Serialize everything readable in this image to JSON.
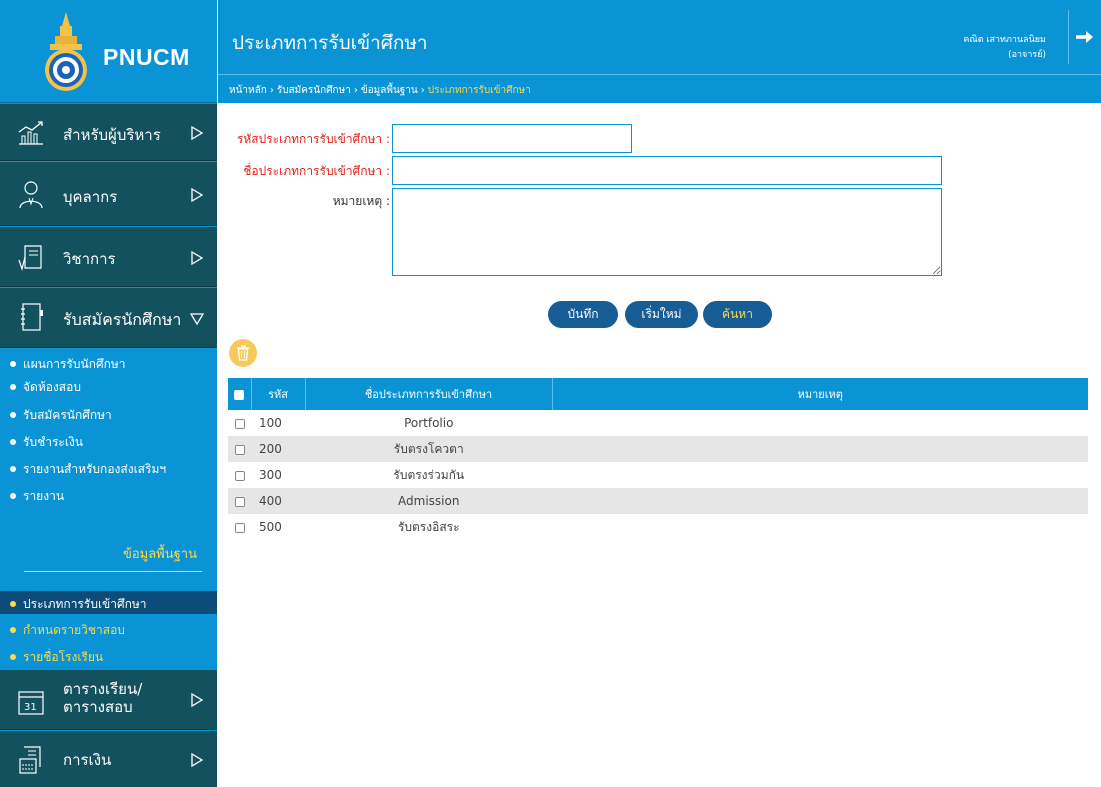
{
  "app": {
    "logo_text": "PNUCM"
  },
  "header": {
    "title": "ประเภทการรับเข้าศึกษา",
    "user_name": "คณิต เสาทภานลนิยม",
    "user_role": "(อาจารย์)"
  },
  "breadcrumb": [
    "หน้าหลัก",
    "รับสมัครนักศึกษา",
    "ข้อมูลพื้นฐาน",
    "ประเภทการรับเข้าศึกษา"
  ],
  "sidebar": {
    "menus": [
      {
        "label": "สำหรับผู้บริหาร",
        "icon": "executive-chart-icon"
      },
      {
        "label": "บุคลากร",
        "icon": "person-icon"
      },
      {
        "label": "วิชาการ",
        "icon": "academic-document-icon"
      },
      {
        "label": "รับสมัครนักศึกษา",
        "icon": "notebook-icon"
      },
      {
        "label_line1": "ตารางเรียน/",
        "label_line2": "ตารางสอบ",
        "icon": "calendar-icon"
      },
      {
        "label": "การเงิน",
        "icon": "finance-icon"
      }
    ],
    "admission_items": [
      "แผนการรับนักศึกษา",
      "จัดห้องสอบ",
      "รับสมัครนักศึกษา",
      "รับชำระเงิน",
      "รายงานสำหรับกองส่งเสริมฯ",
      "รายงาน"
    ],
    "basic_heading": "ข้อมูลพื้นฐาน",
    "basic_items": [
      "ประเภทการรับเข้าศึกษา",
      "กำหนดรายวิชาสอบ",
      "รายชื่อโรงเรียน"
    ]
  },
  "form": {
    "code_label": "รหัสประเภทการรับเข้าศึกษา :",
    "code_value": "",
    "name_label": "ชื่อประเภทการรับเข้าศึกษา :",
    "name_value": "",
    "note_label": "หมายเหตุ :",
    "note_value": ""
  },
  "buttons": {
    "save": "บันทึก",
    "reset": "เริ่มใหม่",
    "search": "ค้นหา"
  },
  "table": {
    "headers": {
      "code": "รหัส",
      "name": "ชื่อประเภทการรับเข้าศึกษา",
      "note": "หมายเหตุ"
    },
    "rows": [
      {
        "code": "100",
        "name": "Portfolio",
        "note": ""
      },
      {
        "code": "200",
        "name": "รับตรงโควตา",
        "note": ""
      },
      {
        "code": "300",
        "name": "รับตรงร่วมกัน",
        "note": ""
      },
      {
        "code": "400",
        "name": "Admission",
        "note": ""
      },
      {
        "code": "500",
        "name": "รับตรงอิสระ",
        "note": ""
      }
    ]
  },
  "colors": {
    "primary": "#0a94d6",
    "sidebar_dark": "#14515f",
    "accent_yellow": "#ffd84a",
    "required_red": "#e2231a",
    "button_navy": "#175c94"
  }
}
